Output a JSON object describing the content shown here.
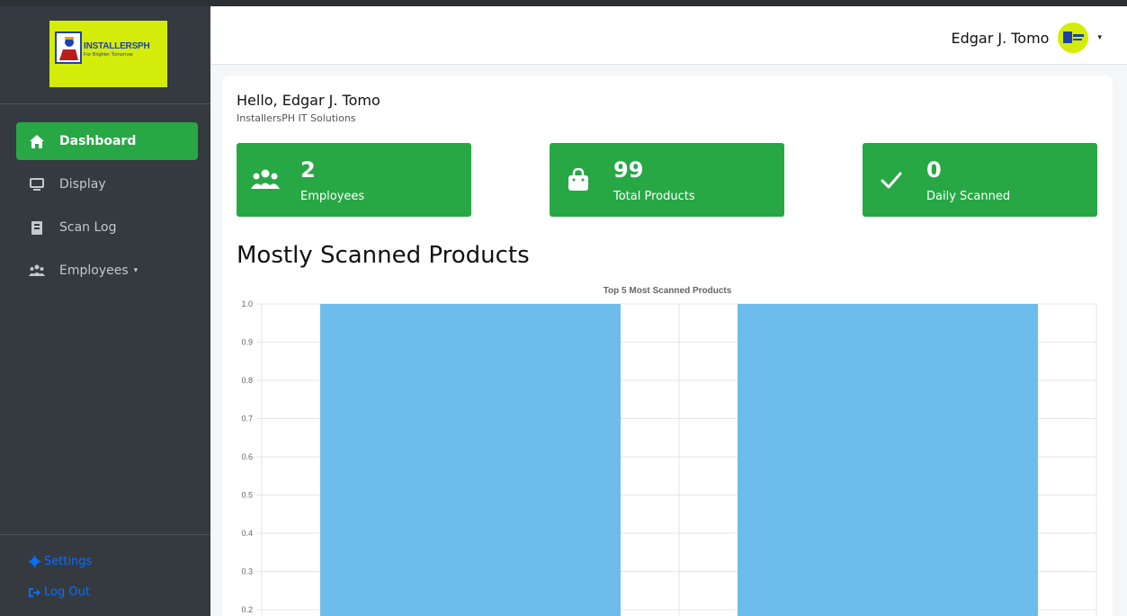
{
  "sidebar": {
    "logo": {
      "title": "INSTALLERSPH",
      "subtitle": "For Brighter Tomorrow"
    },
    "items": [
      {
        "label": "Dashboard",
        "icon": "home-icon",
        "active": true
      },
      {
        "label": "Display",
        "icon": "monitor-icon"
      },
      {
        "label": "Scan Log",
        "icon": "book-icon"
      },
      {
        "label": "Employees",
        "icon": "users-icon",
        "has_caret": true
      }
    ],
    "settings_label": "Settings",
    "logout_label": "Log Out"
  },
  "header": {
    "user_name": "Edgar J. Tomo"
  },
  "main": {
    "greeting": "Hello, Edgar J. Tomo",
    "company": "InstallersPH IT Solutions",
    "stats": [
      {
        "value": "2",
        "label": "Employees",
        "icon": "users-icon"
      },
      {
        "value": "99",
        "label": "Total Products",
        "icon": "shopping-bag-icon"
      },
      {
        "value": "0",
        "label": "Daily Scanned",
        "icon": "check-icon"
      }
    ],
    "section_title": "Mostly Scanned Products"
  },
  "colors": {
    "accent": "#28a745",
    "sidebar_bg": "#343a40",
    "bar": "#6cbcec",
    "link": "#0d6efd",
    "logo_bg": "#d4ec0a"
  },
  "chart_data": {
    "type": "bar",
    "title": "Top 5 Most Scanned Products",
    "categories": [
      "",
      ""
    ],
    "values": [
      1,
      1
    ],
    "y_ticks": [
      "1.0",
      "0.9",
      "0.8",
      "0.7",
      "0.6",
      "0.5",
      "0.4",
      "0.3",
      "0.2"
    ],
    "ylim": [
      0,
      1
    ],
    "grid": true
  }
}
